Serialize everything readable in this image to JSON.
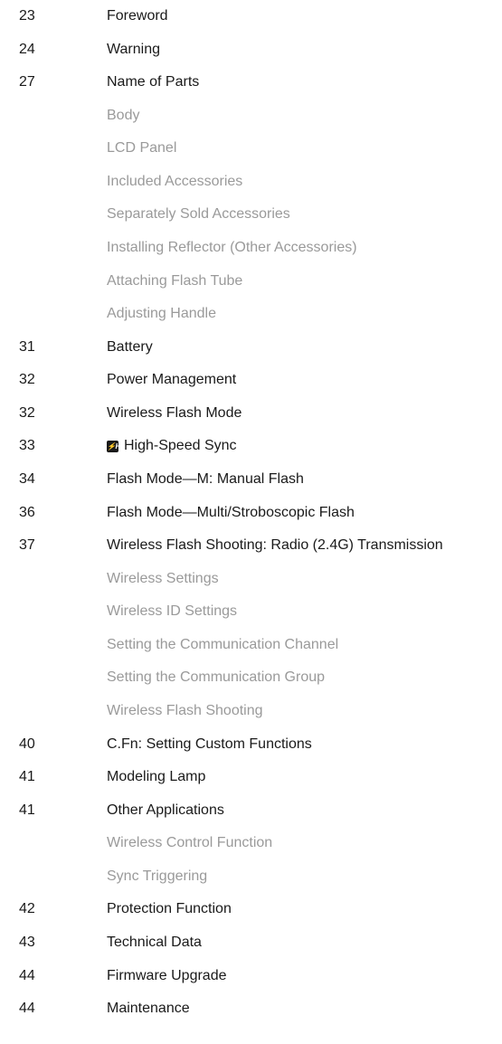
{
  "toc": [
    {
      "page": "23",
      "title": "Foreword",
      "level": 1
    },
    {
      "page": "24",
      "title": "Warning",
      "level": 1
    },
    {
      "page": "27",
      "title": "Name of Parts",
      "level": 1
    },
    {
      "page": "",
      "title": "Body",
      "level": 2
    },
    {
      "page": "",
      "title": "LCD Panel",
      "level": 2
    },
    {
      "page": "",
      "title": "Included Accessories",
      "level": 2
    },
    {
      "page": "",
      "title": "Separately Sold Accessories",
      "level": 2
    },
    {
      "page": "",
      "title": "Installing Reflector (Other Accessories)",
      "level": 2
    },
    {
      "page": "",
      "title": "Attaching Flash Tube",
      "level": 2
    },
    {
      "page": "",
      "title": "Adjusting Handle",
      "level": 2
    },
    {
      "page": "31",
      "title": "Battery",
      "level": 1
    },
    {
      "page": "32",
      "title": "Power Management",
      "level": 1
    },
    {
      "page": "32",
      "title": "Wireless Flash Mode",
      "level": 1
    },
    {
      "page": "33",
      "title": "High-Speed Sync",
      "level": 1,
      "icon": "high-speed-sync-icon"
    },
    {
      "page": "34",
      "title": "Flash Mode—M: Manual Flash",
      "level": 1
    },
    {
      "page": "36",
      "title": "Flash Mode—Multi/Stroboscopic Flash",
      "level": 1
    },
    {
      "page": "37",
      "title": "Wireless Flash Shooting: Radio (2.4G) Transmission",
      "level": 1
    },
    {
      "page": "",
      "title": "Wireless Settings",
      "level": 2
    },
    {
      "page": "",
      "title": "Wireless ID Settings",
      "level": 2
    },
    {
      "page": "",
      "title": "Setting the Communication Channel",
      "level": 2
    },
    {
      "page": "",
      "title": "Setting the Communication Group",
      "level": 2
    },
    {
      "page": "",
      "title": "Wireless Flash Shooting",
      "level": 2
    },
    {
      "page": "40",
      "title": "C.Fn: Setting Custom Functions",
      "level": 1
    },
    {
      "page": "41",
      "title": "Modeling Lamp",
      "level": 1
    },
    {
      "page": "41",
      "title": "Other Applications",
      "level": 1
    },
    {
      "page": "",
      "title": "Wireless Control Function",
      "level": 2
    },
    {
      "page": "",
      "title": "Sync Triggering",
      "level": 2
    },
    {
      "page": "42",
      "title": "Protection Function",
      "level": 1
    },
    {
      "page": "43",
      "title": "Technical Data",
      "level": 1
    },
    {
      "page": "44",
      "title": "Firmware Upgrade",
      "level": 1
    },
    {
      "page": "44",
      "title": "Maintenance",
      "level": 1
    }
  ],
  "colors": {
    "text": "#1a1a1a",
    "subtext": "#9a9a9a",
    "background": "#ffffff"
  }
}
